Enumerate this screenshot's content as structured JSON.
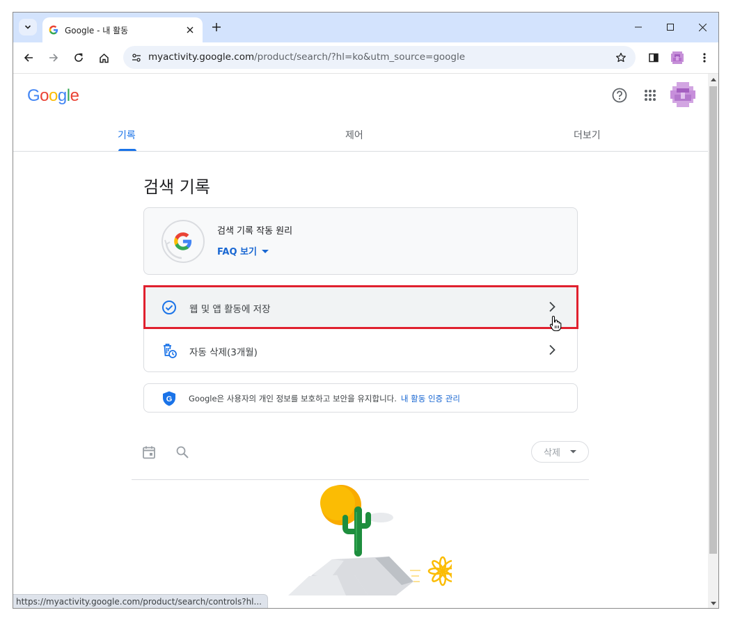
{
  "browser": {
    "tab_title": "Google - 내 활동",
    "url_host": "myactivity.google.com",
    "url_path": "/product/search/?hl=ko&utm_source=google",
    "status_url": "https://myactivity.google.com/product/search/controls?hl..."
  },
  "header": {
    "logo_text": "Google",
    "tabs": [
      {
        "label": "기록",
        "active": true
      },
      {
        "label": "제어",
        "active": false
      },
      {
        "label": "더보기",
        "active": false
      }
    ]
  },
  "main": {
    "page_title": "검색 기록",
    "info_card": {
      "title": "검색 기록 작동 원리",
      "faq_label": "FAQ 보기"
    },
    "settings": [
      {
        "label": "웹 및 앱 활동에 저장",
        "icon": "check-circle-icon"
      },
      {
        "label": "자동 삭제(3개월)",
        "icon": "auto-delete-icon"
      }
    ],
    "privacy": {
      "text": "Google은 사용자의 개인 정보를 보호하고 보안을 유지합니다.",
      "link": "내 활동 인증 관리"
    },
    "delete_label": "삭제"
  },
  "colors": {
    "accent": "#1a73e8",
    "highlight": "#e0202e",
    "tabstrip": "#d3e3fd"
  }
}
